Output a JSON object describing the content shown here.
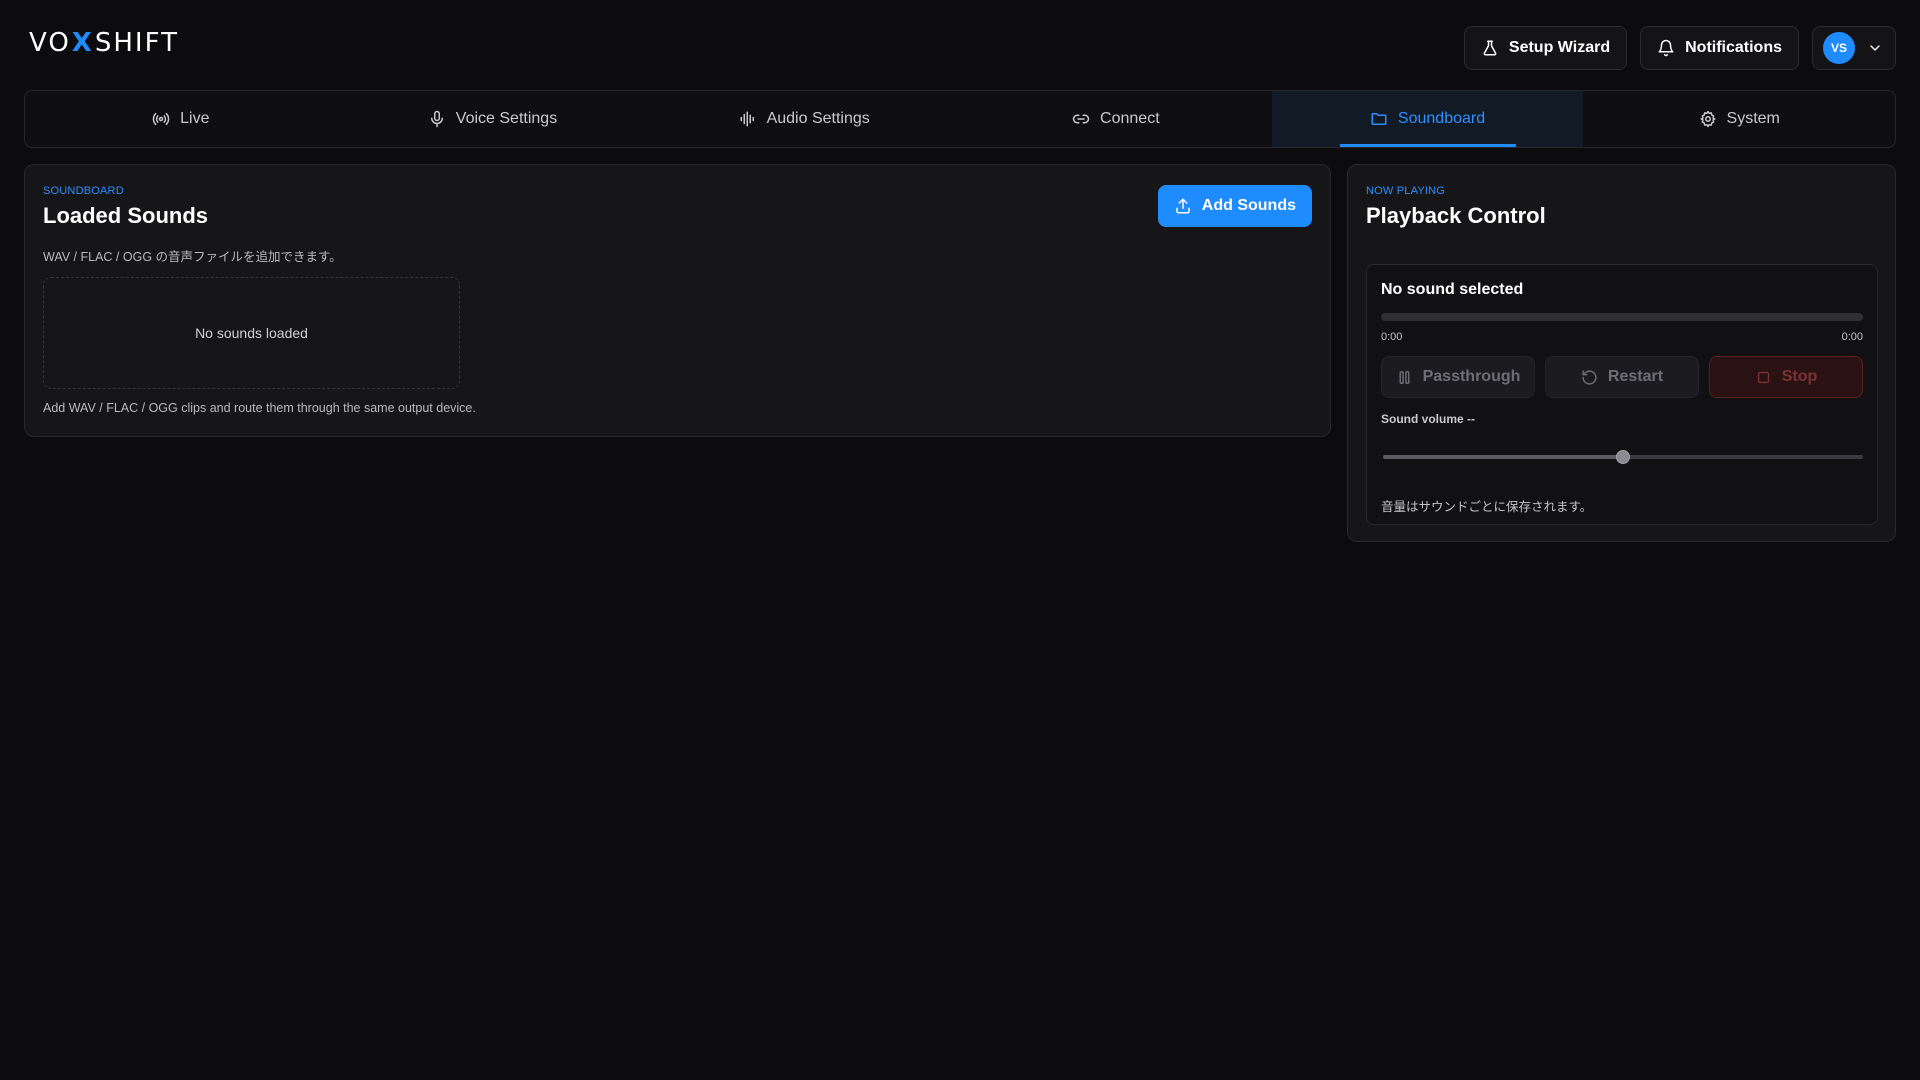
{
  "header": {
    "logo": {
      "left": "VO",
      "x": "X",
      "right": "SHIFT"
    },
    "setup_wizard_label": "Setup Wizard",
    "notifications_label": "Notifications",
    "user_initials": "VS"
  },
  "tabs": [
    {
      "label": "Live",
      "icon": "broadcast-icon"
    },
    {
      "label": "Voice Settings",
      "icon": "microphone-icon"
    },
    {
      "label": "Audio Settings",
      "icon": "waveform-icon"
    },
    {
      "label": "Connect",
      "icon": "link-icon"
    },
    {
      "label": "Soundboard",
      "icon": "folder-icon",
      "active": true
    },
    {
      "label": "System",
      "icon": "gear-icon"
    }
  ],
  "loaded_sounds": {
    "eyebrow": "SOUNDBOARD",
    "title": "Loaded Sounds",
    "add_button_label": "Add Sounds",
    "description": "WAV / FLAC / OGG の音声ファイルを追加できます。",
    "empty_text": "No sounds loaded",
    "footer_note": "Add WAV / FLAC / OGG clips and route them through the same output device."
  },
  "playback": {
    "eyebrow": "NOW PLAYING",
    "title": "Playback Control",
    "current_sound": "No sound selected",
    "progress": 0,
    "time_current": "0:00",
    "time_total": "0:00",
    "passthrough_label": "Passthrough",
    "restart_label": "Restart",
    "stop_label": "Stop",
    "volume_label": "Sound volume --",
    "volume_level": 0.5,
    "volume_note": "音量はサウンドごとに保存されます。"
  },
  "colors": {
    "accent": "#1e8bff",
    "background": "#0c0c0e",
    "card": "#161619",
    "stop_red": "#7c3236"
  }
}
